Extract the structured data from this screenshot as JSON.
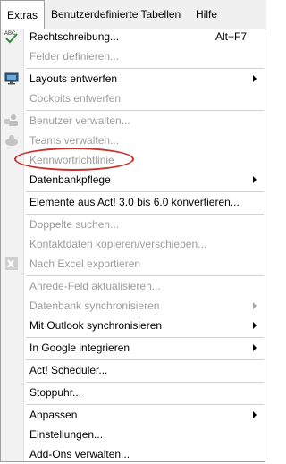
{
  "menubar": {
    "items": [
      {
        "label": "Extras",
        "active": true
      },
      {
        "label": "Benutzerdefinierte Tabellen",
        "active": false
      },
      {
        "label": "Hilfe",
        "active": false
      }
    ]
  },
  "menu": {
    "items": [
      {
        "label": "Rechtschreibung...",
        "shortcut": "Alt+F7",
        "enabled": true,
        "icon": "spellcheck-icon"
      },
      {
        "label": "Felder definieren...",
        "enabled": false
      },
      {
        "label": "Layouts entwerfen",
        "enabled": true,
        "submenu": true,
        "icon": "monitor-icon"
      },
      {
        "label": "Cockpits entwerfen",
        "enabled": false
      },
      {
        "label": "Benutzer verwalten...",
        "enabled": false,
        "icon": "users-icon"
      },
      {
        "label": "Teams verwalten...",
        "enabled": false,
        "icon": "team-icon"
      },
      {
        "label": "Kennwortrichtlinie",
        "enabled": false,
        "annotated": true
      },
      {
        "label": "Datenbankpflege",
        "enabled": true,
        "submenu": true
      },
      {
        "label": "Elemente aus Act! 3.0 bis 6.0 konvertieren...",
        "enabled": true
      },
      {
        "label": "Doppelte suchen...",
        "enabled": false
      },
      {
        "label": "Kontaktdaten kopieren/verschieben...",
        "enabled": false
      },
      {
        "label": "Nach Excel exportieren",
        "enabled": false,
        "icon": "excel-icon"
      },
      {
        "label": "Anrede-Feld aktualisieren...",
        "enabled": false
      },
      {
        "label": "Datenbank synchronisieren",
        "enabled": false,
        "submenu": true
      },
      {
        "label": "Mit Outlook synchronisieren",
        "enabled": true,
        "submenu": true
      },
      {
        "label": "In Google integrieren",
        "enabled": true,
        "submenu": true
      },
      {
        "label": "Act! Scheduler...",
        "enabled": true
      },
      {
        "label": "Stoppuhr...",
        "enabled": true
      },
      {
        "label": "Anpassen",
        "enabled": true,
        "submenu": true
      },
      {
        "label": "Einstellungen...",
        "enabled": true
      },
      {
        "label": "Add-Ons verwalten...",
        "enabled": true
      }
    ]
  },
  "colors": {
    "menubar_bg": "#f0f0f0",
    "gutter_bg": "#f2f2f2",
    "disabled_text": "#9d9d9d",
    "annotation": "#c9302c"
  }
}
